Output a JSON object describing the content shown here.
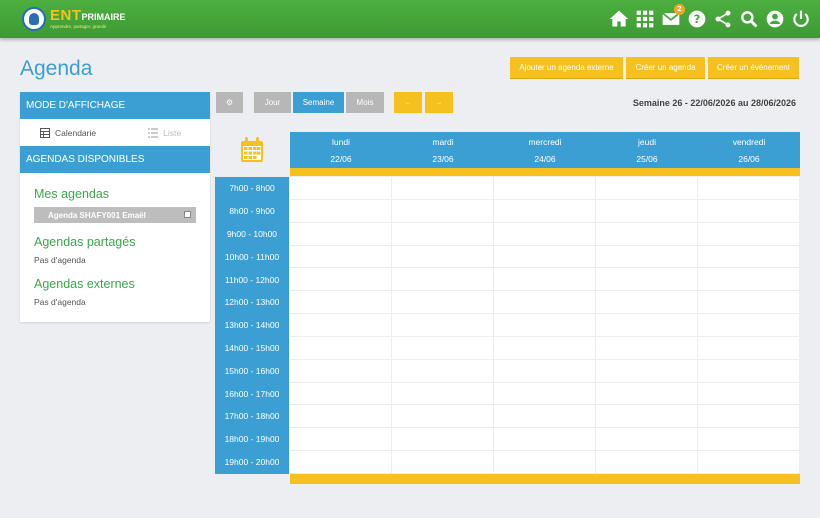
{
  "header": {
    "logo": {
      "ent": "ENT",
      "primaire": "PRIMAIRE",
      "tagline": "Apprendre, partager, grandir"
    },
    "icons": [
      {
        "name": "home-icon"
      },
      {
        "name": "apps-grid-icon"
      },
      {
        "name": "mail-icon",
        "badge": "2"
      },
      {
        "name": "help-icon"
      },
      {
        "name": "share-icon"
      },
      {
        "name": "search-icon"
      },
      {
        "name": "account-icon"
      },
      {
        "name": "power-icon"
      }
    ]
  },
  "page": {
    "title": "Agenda",
    "actions": {
      "add_external": "Ajouter un agenda externe",
      "create_agenda": "Créer un agenda",
      "create_event": "Créer un événement"
    }
  },
  "sidebar": {
    "mode_title": "Mode d'affichage",
    "view_calendar": "Calendarie",
    "view_list": "Liste",
    "available_title": "Agendas disponibles",
    "my_agendas": "Mes agendas",
    "my_agenda_item": "Agenda SHAFY001 Emaël",
    "shared_title": "Agendas partagés",
    "shared_none": "Pas d'agenda",
    "external_title": "Agendas externes",
    "external_none": "Pas d'agenda"
  },
  "toolbar": {
    "settings": "⚙",
    "day": "Jour",
    "week": "Semaine",
    "month": "Mois",
    "prev": "←",
    "next": "→",
    "week_label": "Semaine 26 - 22/06/2026 au 28/06/2026"
  },
  "calendar": {
    "days": [
      {
        "name": "lundi",
        "date": "22/06"
      },
      {
        "name": "mardi",
        "date": "23/06"
      },
      {
        "name": "mercredi",
        "date": "24/06"
      },
      {
        "name": "jeudi",
        "date": "25/06"
      },
      {
        "name": "vendredi",
        "date": "26/06"
      }
    ],
    "slots": [
      "7h00 - 8h00",
      "8h00 - 9h00",
      "9h00 - 10h00",
      "10h00 - 11h00",
      "11h00 - 12h00",
      "12h00 - 13h00",
      "13h00 - 14h00",
      "14h00 - 15h00",
      "15h00 - 16h00",
      "16h00 - 17h00",
      "17h00 - 18h00",
      "18h00 - 19h00",
      "19h00 - 20h00"
    ]
  },
  "colors": {
    "header_green": "#43a83a",
    "primary_blue": "#3c9fd3",
    "accent_yellow": "#f6c11f",
    "title_green": "#3aa84a"
  }
}
